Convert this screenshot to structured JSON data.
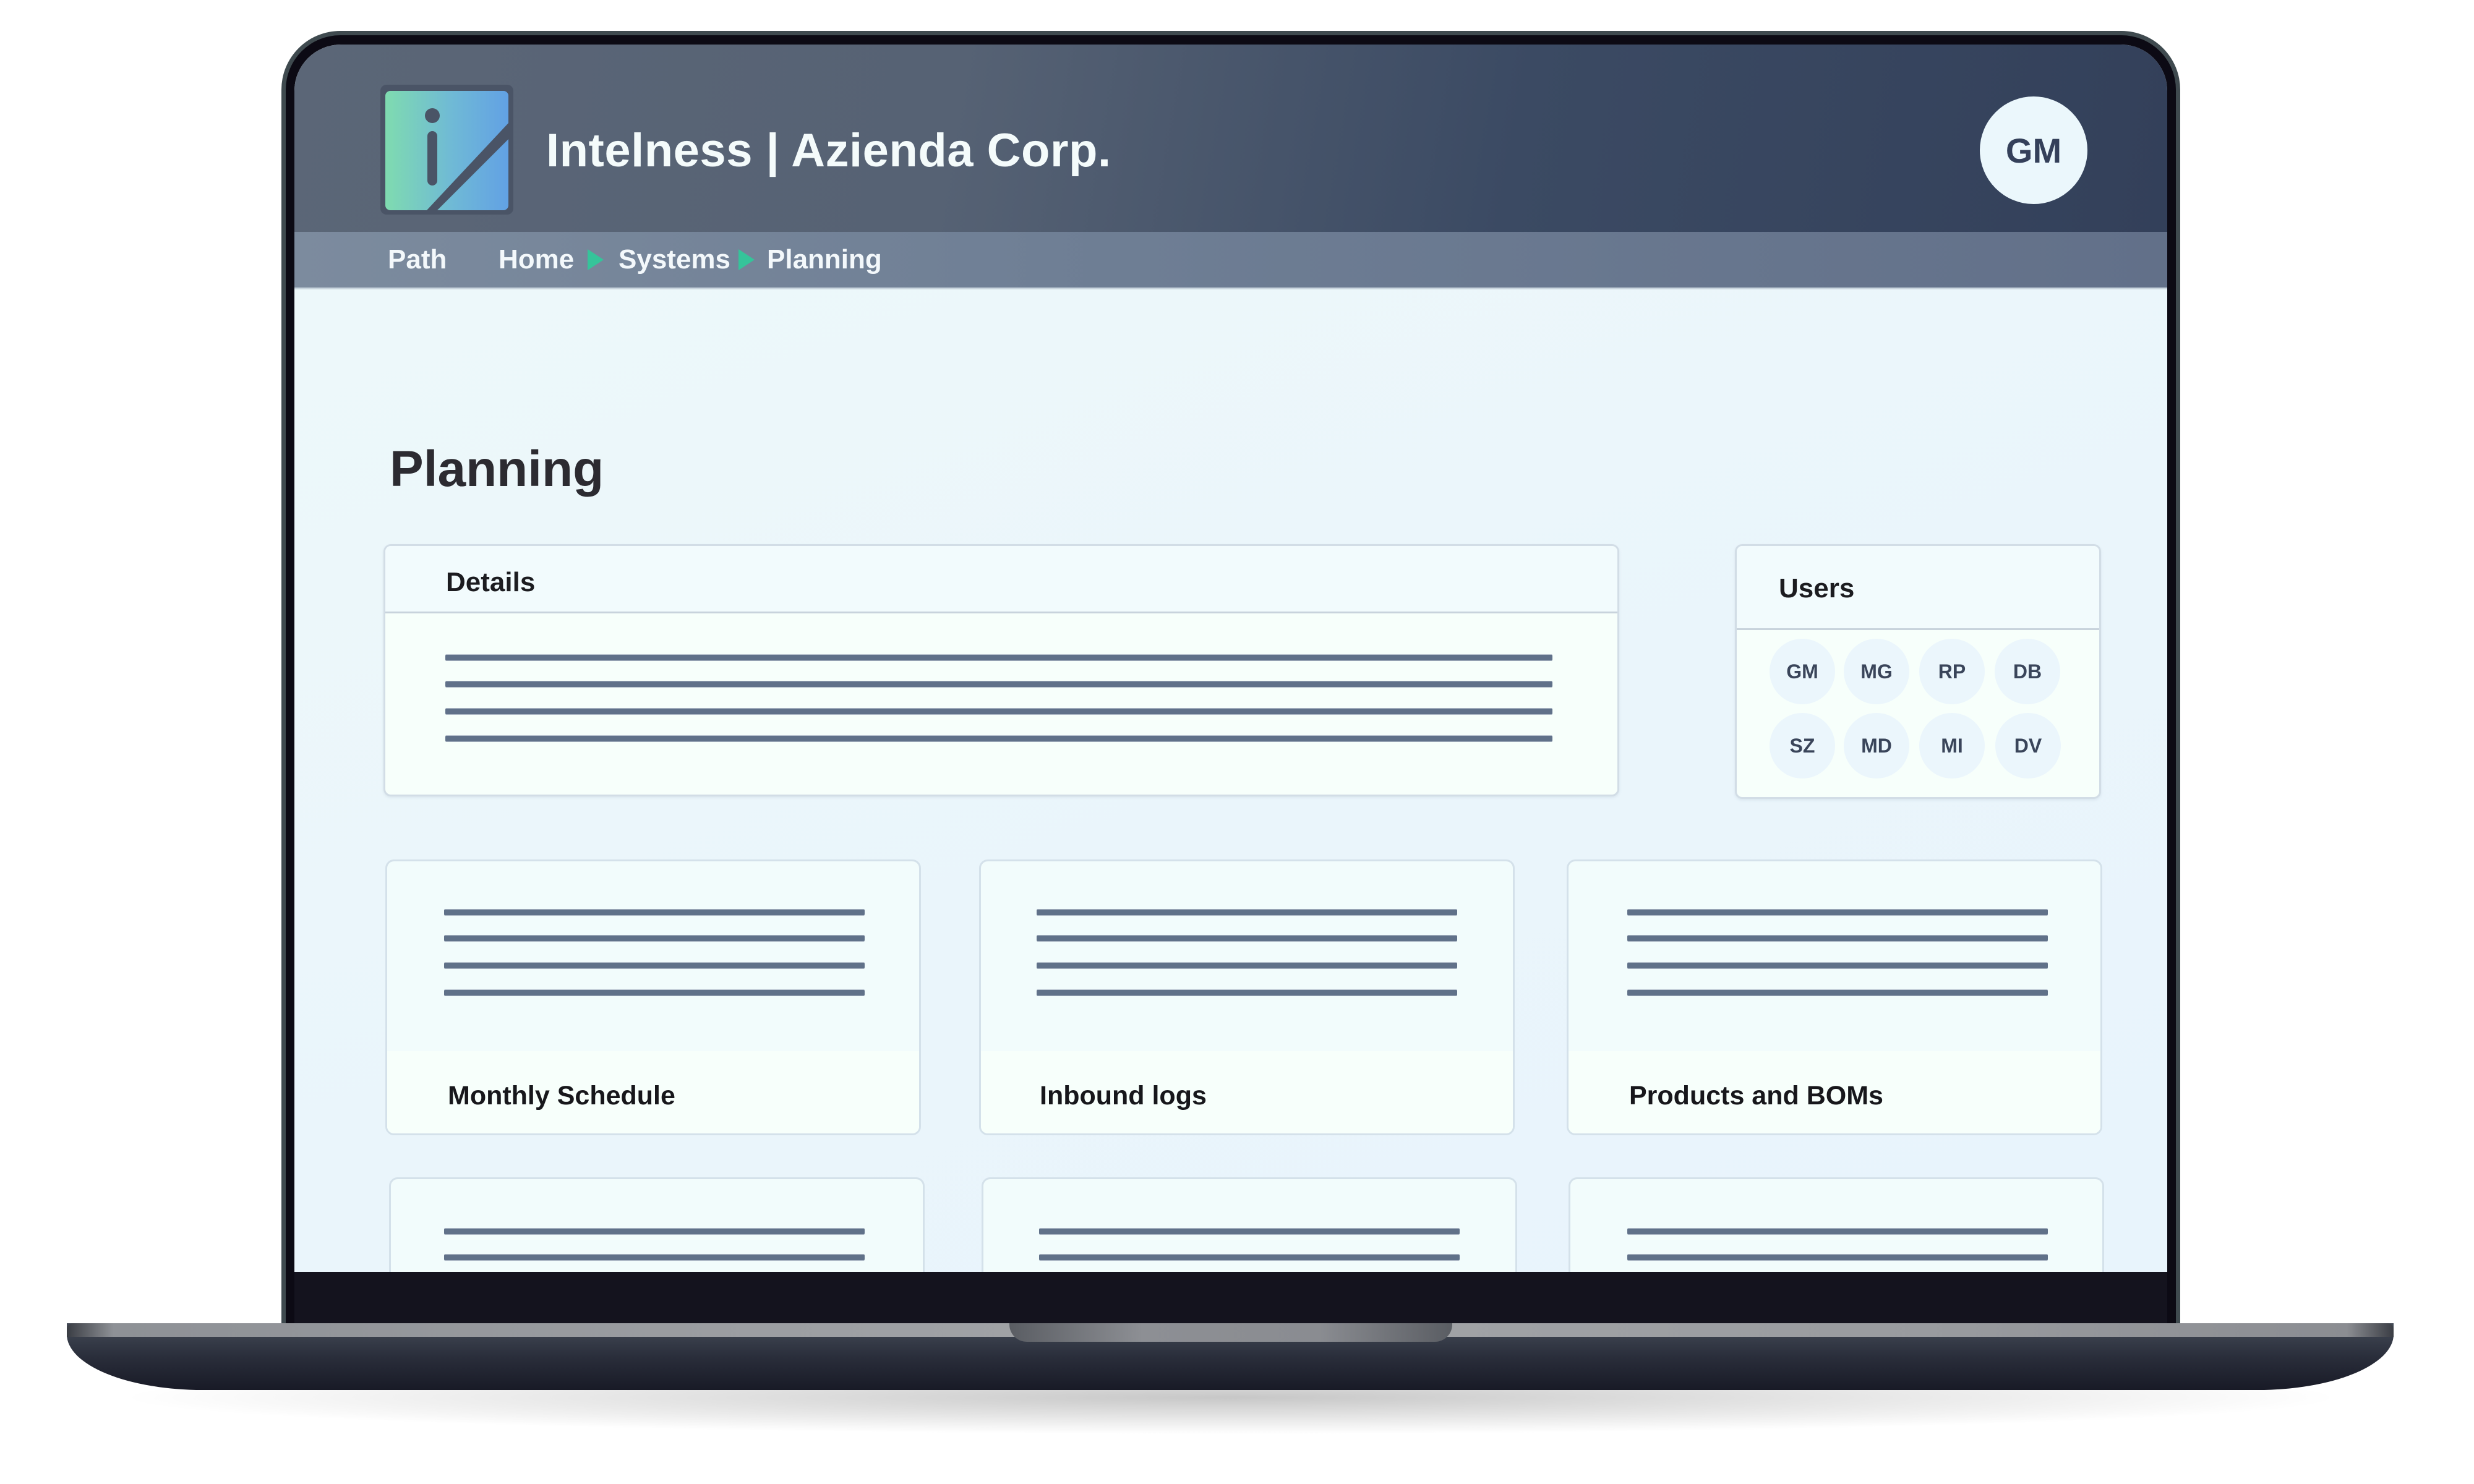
{
  "app": {
    "title": "Intelness | Azienda Corp.",
    "logo_icon": "info-slash-logo",
    "current_user_initials": "GM"
  },
  "breadcrumb": {
    "label": "Path",
    "items": [
      "Home",
      "Systems",
      "Planning"
    ],
    "separator_icon": "triangle-right-icon",
    "separator_color": "#35c49a"
  },
  "page": {
    "title": "Planning"
  },
  "details_card": {
    "title": "Details",
    "placeholder_lines": 4
  },
  "users_card": {
    "title": "Users",
    "users": [
      "GM",
      "MG",
      "RP",
      "DB",
      "SZ",
      "MD",
      "MI",
      "DV"
    ]
  },
  "tiles": [
    {
      "label": "Monthly Schedule"
    },
    {
      "label": "Inbound logs"
    },
    {
      "label": "Products and BOMs"
    },
    {
      "label": ""
    },
    {
      "label": ""
    },
    {
      "label": ""
    }
  ],
  "colors": {
    "header_dark": "#33405a",
    "nav_bar": "#6f7f95",
    "accent_green": "#35c49a",
    "content_bg": "#eaf5fb",
    "placeholder_line": "#607189"
  }
}
